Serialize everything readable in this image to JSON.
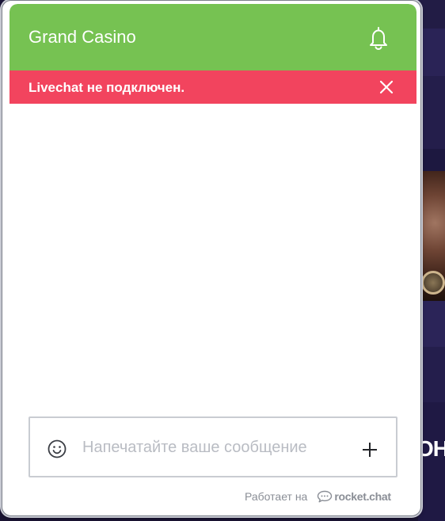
{
  "widget": {
    "title": "Grand Casino",
    "header_color": "#76c252",
    "alert": {
      "message": "Livechat не подключен.",
      "color": "#f2445e"
    },
    "composer": {
      "placeholder": "Напечатайте ваше сообщение",
      "value": ""
    },
    "footer": {
      "powered_by": "Работает на",
      "brand": "rocket.chat"
    },
    "icons": {
      "notifications": "bell-icon",
      "dismiss": "close-icon",
      "emoji": "smiley-icon",
      "attach": "plus-icon",
      "brand_logo": "chat-bubble-icon"
    }
  },
  "background_page": {
    "partial_text": "ОН"
  }
}
